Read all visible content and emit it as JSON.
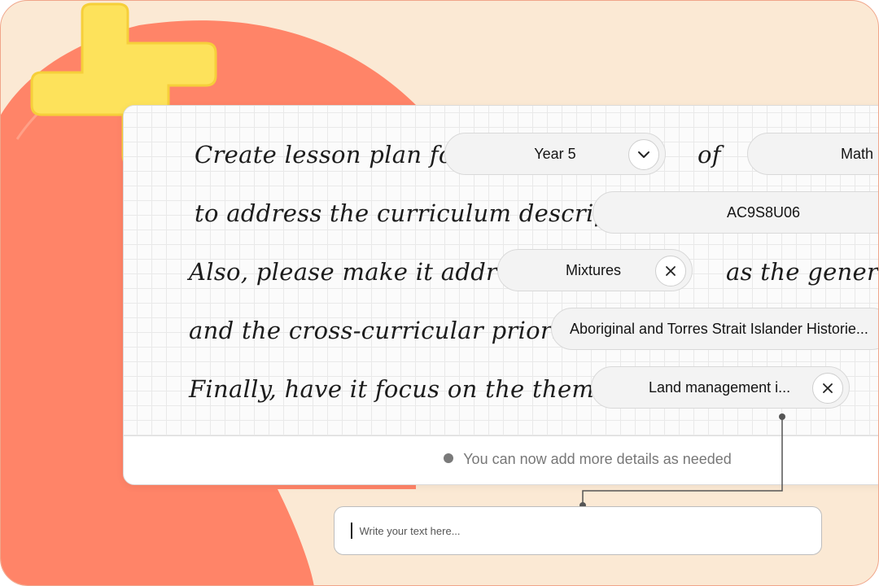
{
  "prompt": {
    "line1_text": "Create lesson plan for",
    "line1_of": "of",
    "line2_text": "to address the curriculum descriptor",
    "line3_text": "Also, please make it address",
    "line3_suffix": "as the general",
    "line4_text": "and the cross-curricular priority",
    "line5_text": "Finally, have it focus on the theme of"
  },
  "fields": {
    "year_level": "Year 5",
    "subject": "Math",
    "descriptor_code": "AC9S8U06",
    "general_topic": "Mixtures",
    "cross_curricular_priority": "Aboriginal and Torres Strait Islander Historie...",
    "theme": "Land management i..."
  },
  "hint_text": "You can now add more details as needed",
  "text_input": {
    "value": "",
    "placeholder": "Write your text here..."
  },
  "colors": {
    "background": "#fbe9d4",
    "blob": "#ff8468",
    "plus": "#fde25b",
    "border": "#f0a58a"
  },
  "icons": {
    "dropdown": "chevron-down-icon",
    "remove": "close-icon"
  }
}
